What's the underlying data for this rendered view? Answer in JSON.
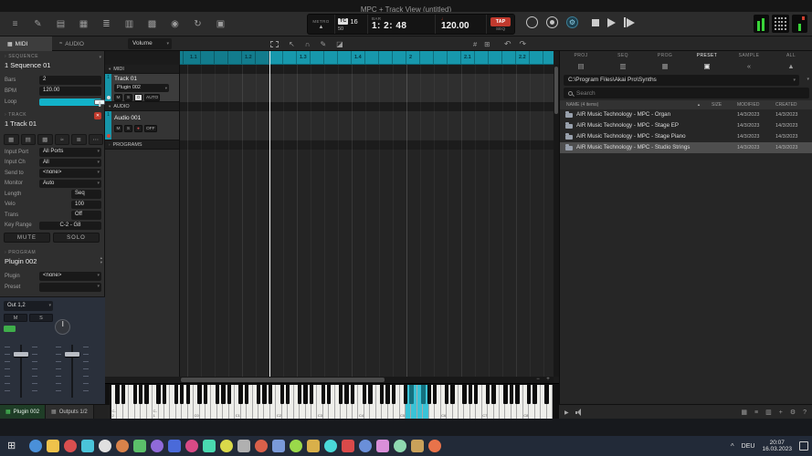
{
  "window": {
    "title": "MPC + Track View (untitled)"
  },
  "icons": {
    "chevron_down": "▾",
    "chevron_up": "▴",
    "collapse_open": "▾",
    "collapse_closed": "›",
    "sort_asc": "▲",
    "close_x": "✕",
    "windows_logo": "⊞",
    "tray_chevron": "^",
    "metronome": "▲",
    "quarter_note": "♩",
    "gear": "⚙",
    "dropdown": "▾"
  },
  "toolbar": {
    "left_icons": [
      {
        "name": "main-menu-icon",
        "glyph": "≡"
      },
      {
        "name": "pencil-edit-icon",
        "glyph": "✎"
      },
      {
        "name": "track-view-icon",
        "glyph": "▤"
      },
      {
        "name": "grid-view-icon",
        "glyph": "▦"
      },
      {
        "name": "mixer-view-icon",
        "glyph": "≣"
      },
      {
        "name": "step-sequencer-icon",
        "glyph": "▥"
      },
      {
        "name": "pad-mixer-icon",
        "glyph": "▩"
      },
      {
        "name": "sampler-icon",
        "glyph": "◉"
      },
      {
        "name": "loop-icon",
        "glyph": "↻"
      },
      {
        "name": "duplicate-icon",
        "glyph": "▣"
      }
    ],
    "transport": {
      "metro_label": "METRO",
      "tc_label": "TC",
      "tc_value": "16",
      "swing_value": "50",
      "bar_label": "BAR",
      "position": "1: 2: 48",
      "bpm": "120.00",
      "tap_label": "TAP",
      "seq_label": "SEQ"
    }
  },
  "subbar": {
    "tabs": [
      {
        "label": "MIDI",
        "icon": "▦"
      },
      {
        "label": "AUDIO",
        "icon": "≈"
      }
    ],
    "active_tab": "MIDI",
    "automation_param": "Volume",
    "tools": [
      {
        "name": "marquee-select-tool-icon",
        "type": "box"
      },
      {
        "name": "pointer-tool-icon",
        "glyph": "↖"
      },
      {
        "name": "magnet-snap-tool-icon",
        "glyph": "∩"
      },
      {
        "name": "pencil-tool-icon",
        "glyph": "✎"
      },
      {
        "name": "eraser-tool-icon",
        "glyph": "◪"
      }
    ],
    "snap_icons": [
      {
        "name": "grid-snap-icon",
        "glyph": "#"
      },
      {
        "name": "quantize-icon",
        "glyph": "⊞"
      }
    ],
    "history_icons": [
      {
        "name": "undo-icon",
        "glyph": "↶"
      },
      {
        "name": "redo-icon",
        "glyph": "↷"
      }
    ]
  },
  "sequence": {
    "section_label": "SEQUENCE",
    "name": "1 Sequence 01",
    "params": [
      {
        "label": "Bars",
        "value": "2"
      },
      {
        "label": "BPM",
        "value": "120.00"
      },
      {
        "label": "Loop",
        "type": "toggle",
        "value": "On"
      }
    ]
  },
  "track": {
    "section_label": "TRACK",
    "name": "1 Track 01",
    "icon_buttons": [
      {
        "name": "track-grid-icon",
        "glyph": "▦"
      },
      {
        "name": "track-keys-icon",
        "glyph": "▤"
      },
      {
        "name": "track-pads-icon",
        "glyph": "▩"
      },
      {
        "name": "track-wave-icon",
        "glyph": "≈"
      },
      {
        "name": "track-mixer-icon",
        "glyph": "≣"
      },
      {
        "name": "track-more-icon",
        "glyph": "⋯"
      }
    ],
    "params": [
      {
        "label": "Input Port",
        "value": "All Ports",
        "dropdown": true
      },
      {
        "label": "Input Ch",
        "value": "All",
        "dropdown": true
      },
      {
        "label": "Send to",
        "value": "<none>",
        "dropdown": true
      },
      {
        "label": "Monitor",
        "value": "Auto",
        "dropdown": true
      },
      {
        "label": "Length",
        "value": "Seq",
        "narrow": true
      },
      {
        "label": "Velo",
        "value": "100",
        "narrow": true
      },
      {
        "label": "Trans",
        "value": "Off",
        "narrow": true
      },
      {
        "label": "Key Range",
        "value": "C-2 - G8",
        "center": true
      }
    ],
    "mute_label": "MUTE",
    "solo_label": "SOLO"
  },
  "program": {
    "section_label": "PROGRAM",
    "name": "Plugin 002",
    "params": [
      {
        "label": "Plugin",
        "value": "<none>",
        "dropdown": true
      },
      {
        "label": "Preset",
        "value": "",
        "dropdown": true
      }
    ]
  },
  "output": {
    "bus": "Out 1,2",
    "mute_label": "M",
    "solo_label": "S"
  },
  "timeline": {
    "groups": [
      {
        "label": "MIDI"
      },
      {
        "label": "AUDIO"
      },
      {
        "label": "PROGRAMS"
      }
    ],
    "midi_track": {
      "number": "1",
      "name": "Track 01",
      "program": "Plugin 002",
      "mute": "M",
      "solo": "S",
      "monitor": "0",
      "auto": "AUTO"
    },
    "audio_track": {
      "number": "1",
      "name": "Audio 001",
      "mute": "M",
      "solo": "S",
      "arm": "●",
      "monitor": "OFF"
    },
    "ruler_labels": [
      "1.1",
      "1.2",
      "1.3",
      "1.4",
      "2",
      "2.1",
      "2.2"
    ]
  },
  "piano": {
    "octave_labels": [
      "C-2",
      "C-1",
      "C0",
      "C1",
      "C2",
      "C3",
      "C4",
      "C5",
      "C6",
      "C7",
      "C8"
    ],
    "highlight": {
      "from": 50,
      "to": 53
    }
  },
  "browser": {
    "filter_tabs": [
      "PROJ",
      "SEQ",
      "PROG",
      "PRESET",
      "SAMPLE",
      "ALL"
    ],
    "active_filter": "PRESET",
    "shortcut_icons": [
      {
        "name": "places-documents-icon",
        "glyph": "▤"
      },
      {
        "name": "places-disk-icon",
        "glyph": "▥"
      },
      {
        "name": "places-expansions-icon",
        "glyph": "▦"
      },
      {
        "name": "places-presets-icon",
        "glyph": "▣",
        "active": true
      },
      {
        "name": "history-back-icon",
        "glyph": "«"
      },
      {
        "name": "eject-icon",
        "glyph": "▲"
      }
    ],
    "path": "C:\\Program Files\\Akai Pro\\Synths",
    "search_placeholder": "Search",
    "columns": [
      "NAME (4 items)",
      "SIZE",
      "MODIFIED",
      "CREATED"
    ],
    "rows": [
      {
        "name": "AIR Music Technology - MPC - Organ",
        "size": "",
        "modified": "14/3/2023",
        "created": "14/3/2023",
        "selected": false
      },
      {
        "name": "AIR Music Technology - MPC - Stage EP",
        "size": "",
        "modified": "14/3/2023",
        "created": "14/3/2023",
        "selected": false
      },
      {
        "name": "AIR Music Technology - MPC - Stage Piano",
        "size": "",
        "modified": "14/3/2023",
        "created": "14/3/2023",
        "selected": false
      },
      {
        "name": "AIR Music Technology - MPC - Studio Strings",
        "size": "",
        "modified": "14/3/2023",
        "created": "14/3/2023",
        "selected": true
      }
    ]
  },
  "bottombar": {
    "tabs": [
      {
        "label": "Plugin 002"
      },
      {
        "label": "Outputs 1/2"
      }
    ],
    "right_icons": [
      {
        "name": "pads-view-icon",
        "glyph": "▦"
      },
      {
        "name": "list-view-icon",
        "glyph": "≡"
      },
      {
        "name": "dual-pane-icon",
        "glyph": "▥"
      },
      {
        "name": "add-icon",
        "glyph": "+"
      },
      {
        "name": "settings-icon",
        "glyph": "⚙"
      },
      {
        "name": "help-icon",
        "glyph": "?"
      }
    ]
  },
  "taskbar": {
    "apps": [
      {
        "name": "taskbar-app-icon",
        "color": "#4a90d9",
        "shape": "circle"
      },
      {
        "name": "taskbar-app-icon",
        "color": "#f0c24b",
        "shape": "square"
      },
      {
        "name": "taskbar-app-icon",
        "color": "#d94f4f",
        "shape": "circle"
      },
      {
        "name": "taskbar-app-icon",
        "color": "#4ac3d9",
        "shape": "square"
      },
      {
        "name": "taskbar-app-icon",
        "color": "#e0e0e0",
        "shape": "circle"
      },
      {
        "name": "taskbar-app-icon",
        "color": "#d9824a",
        "shape": "circle"
      },
      {
        "name": "taskbar-app-icon",
        "color": "#5bbf6a",
        "shape": "square"
      },
      {
        "name": "taskbar-app-icon",
        "color": "#8f6ad9",
        "shape": "circle"
      },
      {
        "name": "taskbar-app-icon",
        "color": "#4a6ad9",
        "shape": "square"
      },
      {
        "name": "taskbar-app-icon",
        "color": "#d94a86",
        "shape": "circle"
      },
      {
        "name": "taskbar-app-icon",
        "color": "#4ad9b0",
        "shape": "square"
      },
      {
        "name": "taskbar-app-icon",
        "color": "#d9d94a",
        "shape": "circle"
      },
      {
        "name": "taskbar-app-icon",
        "color": "#b0b0b0",
        "shape": "square"
      },
      {
        "name": "taskbar-app-icon",
        "color": "#d9604a",
        "shape": "circle"
      },
      {
        "name": "taskbar-app-icon",
        "color": "#7a9ad9",
        "shape": "square"
      },
      {
        "name": "taskbar-app-icon",
        "color": "#9ad94a",
        "shape": "circle"
      },
      {
        "name": "taskbar-app-icon",
        "color": "#d9b04a",
        "shape": "square"
      },
      {
        "name": "taskbar-app-icon",
        "color": "#4ad9d9",
        "shape": "circle"
      },
      {
        "name": "taskbar-app-icon",
        "color": "#d94a4a",
        "shape": "square"
      },
      {
        "name": "taskbar-app-icon",
        "color": "#6a8fd9",
        "shape": "circle"
      },
      {
        "name": "taskbar-app-icon",
        "color": "#d98fd9",
        "shape": "square"
      },
      {
        "name": "taskbar-app-icon",
        "color": "#8fd9b0",
        "shape": "circle"
      },
      {
        "name": "taskbar-app-icon",
        "color": "#c9a15a",
        "shape": "square"
      },
      {
        "name": "taskbar-app-icon",
        "color": "#e8734a",
        "shape": "circle"
      }
    ],
    "tray": {
      "lang": "DEU",
      "time": "20:07",
      "date": "16.03.2023"
    }
  }
}
